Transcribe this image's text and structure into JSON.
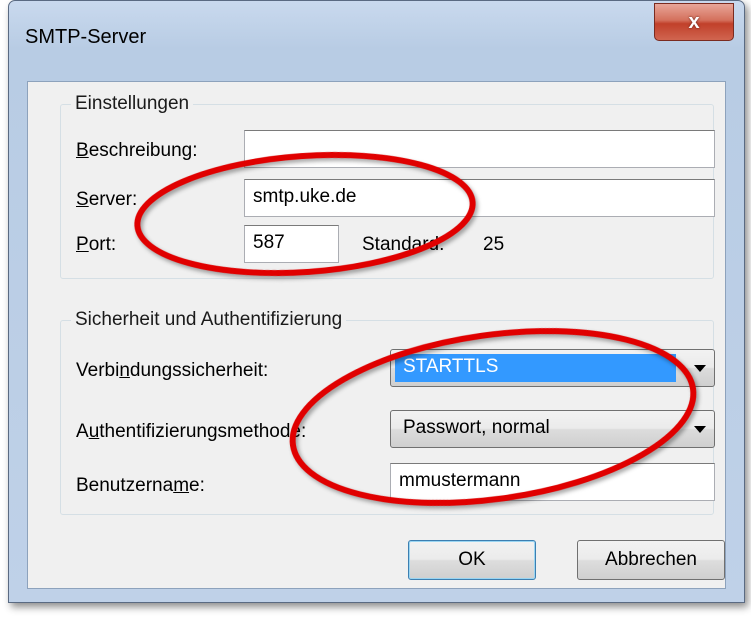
{
  "window": {
    "title": "SMTP-Server",
    "close_glyph": "x"
  },
  "settings": {
    "legend": "Einstellungen",
    "description_label_mnemonic": "B",
    "description_label_rest": "eschreibung:",
    "description_value": "",
    "server_label_mnemonic": "S",
    "server_label_rest": "erver:",
    "server_value": "smtp.uke.de",
    "port_label_mnemonic": "P",
    "port_label_rest": "ort:",
    "port_value": "587",
    "default_label": "Standard:",
    "default_value": "25"
  },
  "security": {
    "legend": "Sicherheit und Authentifizierung",
    "connection_label_pre": "Verbi",
    "connection_label_mnemonic": "n",
    "connection_label_post": "dungssicherheit:",
    "connection_value": "STARTTLS",
    "auth_label_pre": "A",
    "auth_label_mnemonic": "u",
    "auth_label_post": "thentifizierungsmethode:",
    "auth_value": "Passwort, normal",
    "username_label_pre": "Benutzerna",
    "username_label_mnemonic": "m",
    "username_label_post": "e:",
    "username_value": "mmustermann"
  },
  "buttons": {
    "ok_label": "OK",
    "cancel_label": "Abbrechen"
  },
  "colors": {
    "annotation_ring": "#e00000",
    "selection": "#3399ff",
    "close_button": "#c1402a"
  },
  "icons": {
    "close": "close-icon",
    "dropdown": "chevron-down-icon"
  }
}
